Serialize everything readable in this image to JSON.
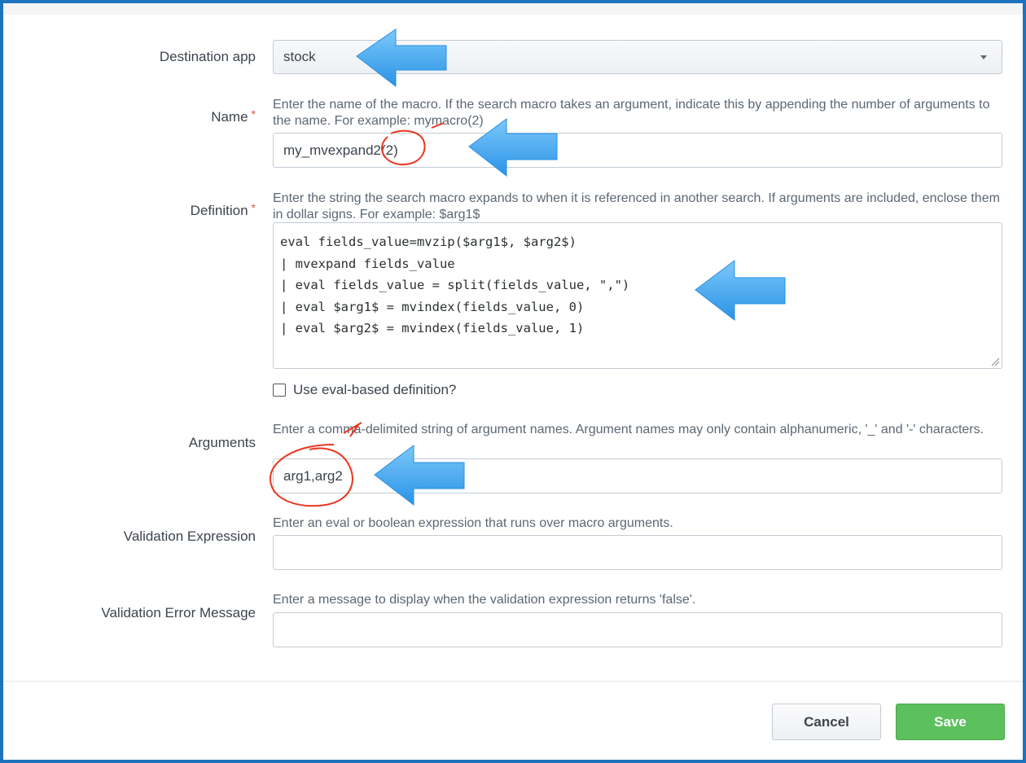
{
  "form": {
    "destination_app": {
      "label": "Destination app",
      "value": "stock"
    },
    "name": {
      "label": "Name",
      "required_mark": "*",
      "help": "Enter the name of the macro. If the search macro takes an argument, indicate this by appending the number of arguments to the name. For example: mymacro(2)",
      "value": "my_mvexpand2(2)"
    },
    "definition": {
      "label": "Definition",
      "required_mark": "*",
      "help": "Enter the string the search macro expands to when it is referenced in another search. If arguments are included, enclose them in dollar signs. For example: $arg1$",
      "lines": [
        "eval fields_value=mvzip($arg1$, $arg2$)",
        "| mvexpand fields_value",
        "| eval fields_value = split(fields_value, \",\")",
        "| eval $arg1$ = mvindex(fields_value, 0)",
        "| eval $arg2$ = mvindex(fields_value, 1)"
      ]
    },
    "eval_based": {
      "label": "Use eval-based definition?",
      "checked": false
    },
    "arguments": {
      "label": "Arguments",
      "help": "Enter a comma-delimited string of argument names. Argument names may only contain alphanumeric, '_' and '-' characters.",
      "value": "arg1,arg2"
    },
    "validation_expression": {
      "label": "Validation Expression",
      "help": "Enter an eval or boolean expression that runs over macro arguments.",
      "value": ""
    },
    "validation_error_message": {
      "label": "Validation Error Message",
      "help": "Enter a message to display when the validation expression returns 'false'.",
      "value": ""
    }
  },
  "buttons": {
    "cancel": "Cancel",
    "save": "Save"
  },
  "colors": {
    "annotation_arrow": "#3aa4f0",
    "annotation_circle": "#e8371f",
    "save_button": "#5cc05c",
    "frame_border": "#1e73be"
  }
}
